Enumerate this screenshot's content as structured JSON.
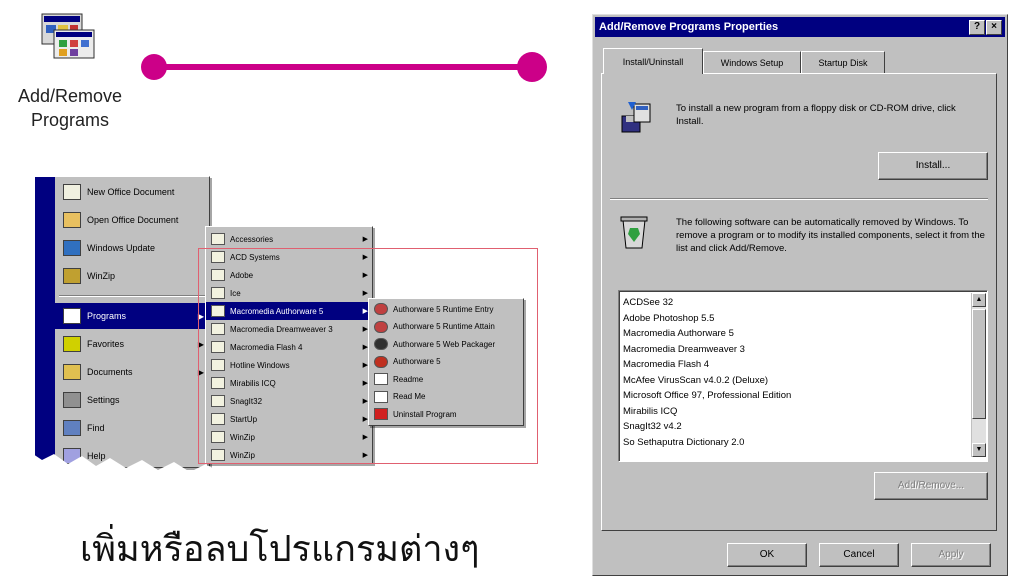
{
  "icon_label_lines": [
    "Add/Remove",
    "Programs"
  ],
  "thai_caption": "เพิ่มหรือลบโปรแกรมต่างๆ",
  "colors": {
    "connector": "#cc0088",
    "highlight_box": "#e06070",
    "titlebar": "#000080",
    "dialog_face": "#c0c0c0"
  },
  "start_menu": {
    "items": [
      {
        "label": "New Office Document",
        "icon": "new-doc-icon"
      },
      {
        "label": "Open Office Document",
        "icon": "open-folder-icon"
      },
      {
        "label": "Windows Update",
        "icon": "globe-icon"
      },
      {
        "label": "WinZip",
        "icon": "winzip-icon"
      },
      {
        "label": "Programs",
        "icon": "programs-icon",
        "selected": true
      },
      {
        "label": "Favorites",
        "icon": "favorites-icon"
      },
      {
        "label": "Documents",
        "icon": "documents-icon"
      },
      {
        "label": "Settings",
        "icon": "settings-icon"
      },
      {
        "label": "Find",
        "icon": "find-icon"
      },
      {
        "label": "Help",
        "icon": "help-icon"
      }
    ]
  },
  "programs_menu": {
    "items": [
      {
        "label": "Accessories"
      },
      {
        "label": "ACD Systems"
      },
      {
        "label": "Adobe"
      },
      {
        "label": "Ice"
      },
      {
        "label": "Macromedia Authorware 5",
        "selected": true
      },
      {
        "label": "Macromedia Dreamweaver 3"
      },
      {
        "label": "Macromedia Flash 4"
      },
      {
        "label": "Hotline Windows"
      },
      {
        "label": "Mirabilis ICQ"
      },
      {
        "label": "SnagIt32"
      },
      {
        "label": "StartUp"
      },
      {
        "label": "WinZip"
      },
      {
        "label": "WinZip"
      }
    ]
  },
  "authorware_menu": {
    "items": [
      {
        "label": "Authorware 5 Runtime Entry",
        "icon": "runtime-icon"
      },
      {
        "label": "Authorware 5 Runtime Attain",
        "icon": "runtime-icon"
      },
      {
        "label": "Authorware 5 Web Packager",
        "icon": "packager-icon"
      },
      {
        "label": "Authorware 5",
        "icon": "authorware-icon"
      },
      {
        "label": "Readme",
        "icon": "readme-icon"
      },
      {
        "label": "Read Me",
        "icon": "readme-icon"
      },
      {
        "label": "Uninstall Program",
        "icon": "uninstall-icon"
      }
    ]
  },
  "dialog": {
    "title": "Add/Remove Programs Properties",
    "help_button": "?",
    "close_button": "×",
    "tabs": [
      {
        "label": "Install/Uninstall",
        "active": true
      },
      {
        "label": "Windows Setup"
      },
      {
        "label": "Startup Disk"
      }
    ],
    "install_text": "To install a new program from a floppy disk or CD-ROM drive, click Install.",
    "install_button": "Install...",
    "remove_text": "The following software can be automatically removed by Windows. To remove a program or to modify its installed components, select it from the list and click Add/Remove.",
    "programs": [
      "ACDSee 32",
      "Adobe Photoshop 5.5",
      "Macromedia Authorware 5",
      "Macromedia Dreamweaver 3",
      "Macromedia Flash 4",
      "McAfee VirusScan v4.0.2 (Deluxe)",
      "Microsoft Office 97, Professional Edition",
      "Mirabilis ICQ",
      "SnagIt32 v4.2",
      "So Sethaputra Dictionary 2.0"
    ],
    "add_remove_button": "Add/Remove...",
    "ok_button": "OK",
    "cancel_button": "Cancel",
    "apply_button": "Apply"
  }
}
